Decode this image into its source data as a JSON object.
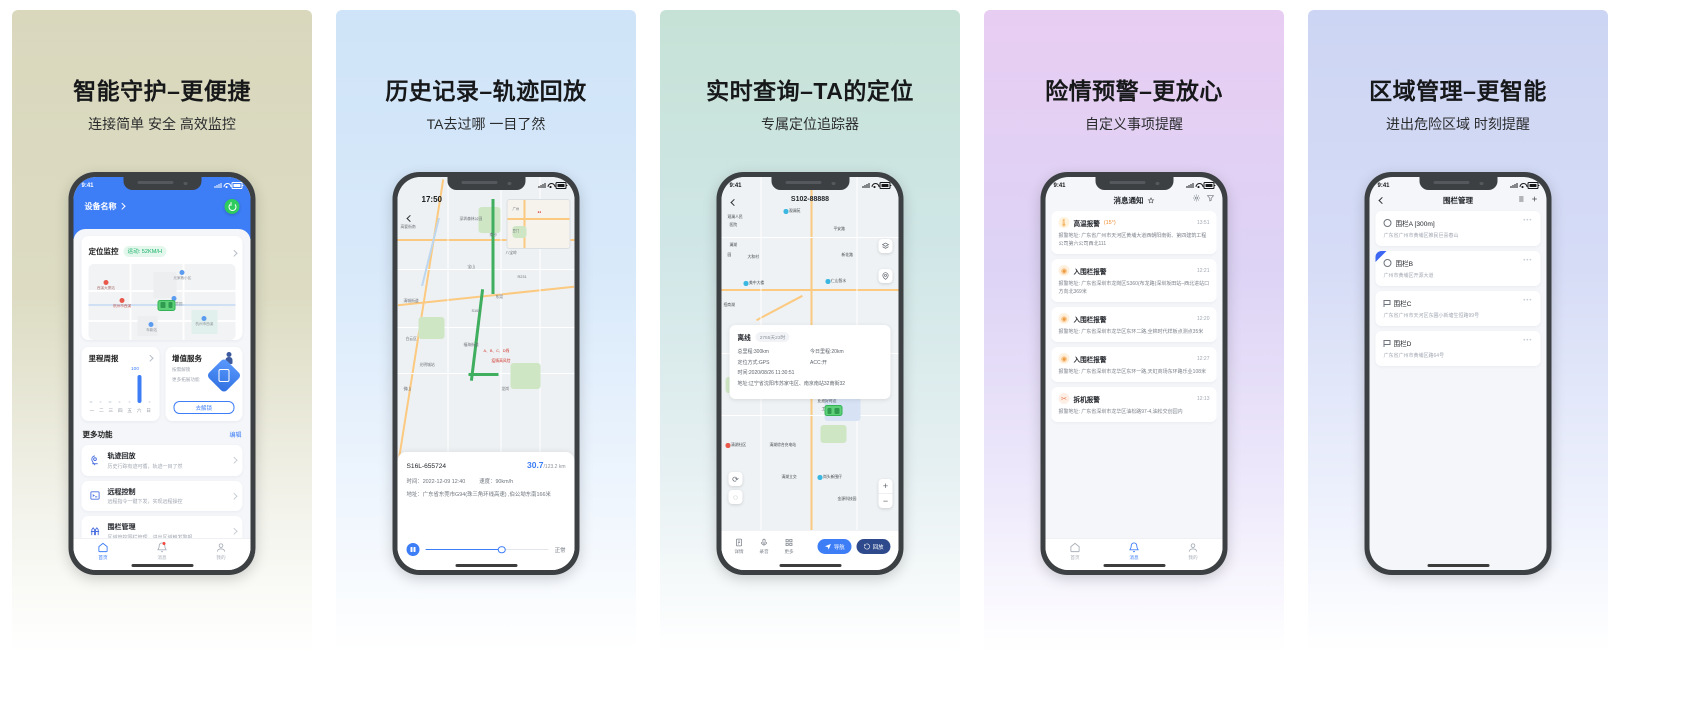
{
  "panels": [
    {
      "title": "智能守护–更便捷",
      "subtitle": "连接简单 安全 高效监控",
      "accent": "#3d7df6",
      "phone": {
        "status_time": "9:41",
        "device_name": "设备名称",
        "monitor_title": "定位监控",
        "monitor_badge": "运动: 52KM/H",
        "map_pois": [
          "元家巷小区",
          "杭州市西溪\n特殊医院",
          "现代创意园",
          "西溪大厦站",
          "车新站",
          "杭州市西溪\n实验中学"
        ],
        "mileage_title": "里程周报",
        "mileage_value": "100",
        "weekdays": [
          "一",
          "二",
          "三",
          "四",
          "五",
          "六",
          "日"
        ],
        "vas_title": "增值服务",
        "vas_line1": "按需解锁",
        "vas_line2": "更多拓展功能",
        "vas_button": "去解锁",
        "section_title": "更多功能",
        "section_edit": "编辑",
        "features": [
          {
            "icon": "track-icon",
            "title": "轨迹回放",
            "desc": "历史行踪有迹可循，轨迹一目了然"
          },
          {
            "icon": "remote-icon",
            "title": "远程控制",
            "desc": "远程指令一键下发，实现远程操控"
          },
          {
            "icon": "fence-icon",
            "title": "围栏管理",
            "desc": "区域管控围栏管理，进出区域触发警报"
          }
        ],
        "tabs": [
          {
            "label": "首页",
            "icon": "home-icon",
            "active": true,
            "badge": false
          },
          {
            "label": "消息",
            "icon": "bell-icon",
            "active": false,
            "badge": true
          },
          {
            "label": "我的",
            "icon": "person-icon",
            "active": false,
            "badge": false
          }
        ]
      }
    },
    {
      "title": "历史记录–轨迹回放",
      "subtitle": "TA去过哪 一目了然",
      "accent": "#3d7df6",
      "phone": {
        "map_time": "17:50",
        "map_labels": [
          "八宝岭",
          "广州",
          "深圳森林公园",
          "城站",
          "清城",
          "光明城站",
          "疫情高风险",
          "R231",
          "S105",
          "佛山",
          "南沙",
          "东莞",
          "A、B、C、D线"
        ],
        "device_id": "S16L-655724",
        "distance": "30.7",
        "distance_total": "/123.2 km",
        "time_label": "时间：",
        "time_value": "2022-12-09 12:40",
        "speed_label": "速度：",
        "speed_value": "90km/h",
        "addr_label": "地址：",
        "addr_value": "广东省东莞市G94(珠三角环线高速) ,伯公坳东南166米",
        "state": "正常"
      }
    },
    {
      "title": "实时查询–TA的定位",
      "subtitle": "专属定位追踪器",
      "accent": "#3d7df6",
      "phone": {
        "status_time": "9:41",
        "header_title": "S102-88888",
        "map_pois": [
          "观澜人民\n医院",
          "观澜苑",
          "平安路",
          "大和村",
          "美中大楼",
          "仁山智水",
          "招商湖",
          "龙华·花季里",
          "亚迪好时达\n工业厂区",
          "清湖社区",
          "清湖综合充电站",
          "岗头新围仔",
          "清湖立交",
          "龙华科技工业",
          "金源科技园",
          "安发科技工业"
        ],
        "status": "离线",
        "days": "2755天23时",
        "total_label": "总里程:300km",
        "today_label": "今日里程:20km",
        "locate_label": "定位方式:GPS",
        "acc_label": "ACC:开",
        "time_label": "时间:2020/08/26 11:30:51",
        "addr_label": "地址:辽宁省沈阳市苏家屯区、南京南站32南街32",
        "actions": [
          {
            "label": "详情",
            "icon": "detail-icon"
          },
          {
            "label": "录音",
            "icon": "mic-icon"
          },
          {
            "label": "更多",
            "icon": "grid-icon"
          }
        ],
        "pill_nav": "导航",
        "pill_track": "回放"
      }
    },
    {
      "title": "险情预警–更放心",
      "subtitle": "自定义事项提醒",
      "accent": "#3d7df6",
      "phone": {
        "status_time": "9:41",
        "header_title": "消息通知",
        "alerts": [
          {
            "icon": "thermometer-icon",
            "name": "高温报警",
            "temp": "(15°)",
            "time": "13:51",
            "body": "报警地址: 广东省广州市天河区黄埔大道西朝阳南街、第四建筑工程公司第六公司西北111"
          },
          {
            "icon": "fence-enter-icon",
            "name": "入围栏报警",
            "temp": "",
            "time": "12:21",
            "body": "报警地址: 广东省深圳市龙岗区S360(布龙路)深圳坂田站–西北进站口方向北369米"
          },
          {
            "icon": "fence-enter-icon",
            "name": "入围栏报警",
            "temp": "",
            "time": "12:20",
            "body": "报警地址: 广东省深圳市龙华区东环二路,全棉时代样板点测点35米"
          },
          {
            "icon": "fence-enter-icon",
            "name": "入围栏报警",
            "temp": "",
            "time": "12:27",
            "body": "报警地址: 广东省深圳市龙华区东环一路,天虹商场东环路乐业108米"
          },
          {
            "icon": "detach-icon",
            "name": "拆机报警",
            "temp": "",
            "time": "12:13",
            "body": "报警地址: 广东省深圳市龙华区油松路97-4,油松交创园内"
          }
        ],
        "tabs": [
          {
            "label": "首页",
            "icon": "home-icon",
            "active": false,
            "badge": false
          },
          {
            "label": "消息",
            "icon": "bell-icon",
            "active": true,
            "badge": false
          },
          {
            "label": "我的",
            "icon": "person-icon",
            "active": false,
            "badge": false
          }
        ]
      }
    },
    {
      "title": "区域管理–更智能",
      "subtitle": "进出危险区域 时刻提醒",
      "accent": "#3d66f2",
      "phone": {
        "status_time": "9:41",
        "header_title": "围栏管理",
        "fences": [
          {
            "icon": "circle-icon",
            "name": "围栏A [300m]",
            "addr": "广东省广州市黄埔区推民巨喜春山",
            "more": "•••",
            "corner": false
          },
          {
            "icon": "circle-icon",
            "name": "围栏B",
            "addr": "广州市黄埔区开源大道",
            "more": "•••",
            "corner": true
          },
          {
            "icon": "polygon-icon",
            "name": "围栏C",
            "addr": "广东省广州市天河区东圃小新塘生恒路99号",
            "more": "•••",
            "corner": false
          },
          {
            "icon": "polygon-icon",
            "name": "围栏D",
            "addr": "广东省广州市黄埔区路64号",
            "more": "•••",
            "corner": false
          }
        ]
      }
    }
  ]
}
